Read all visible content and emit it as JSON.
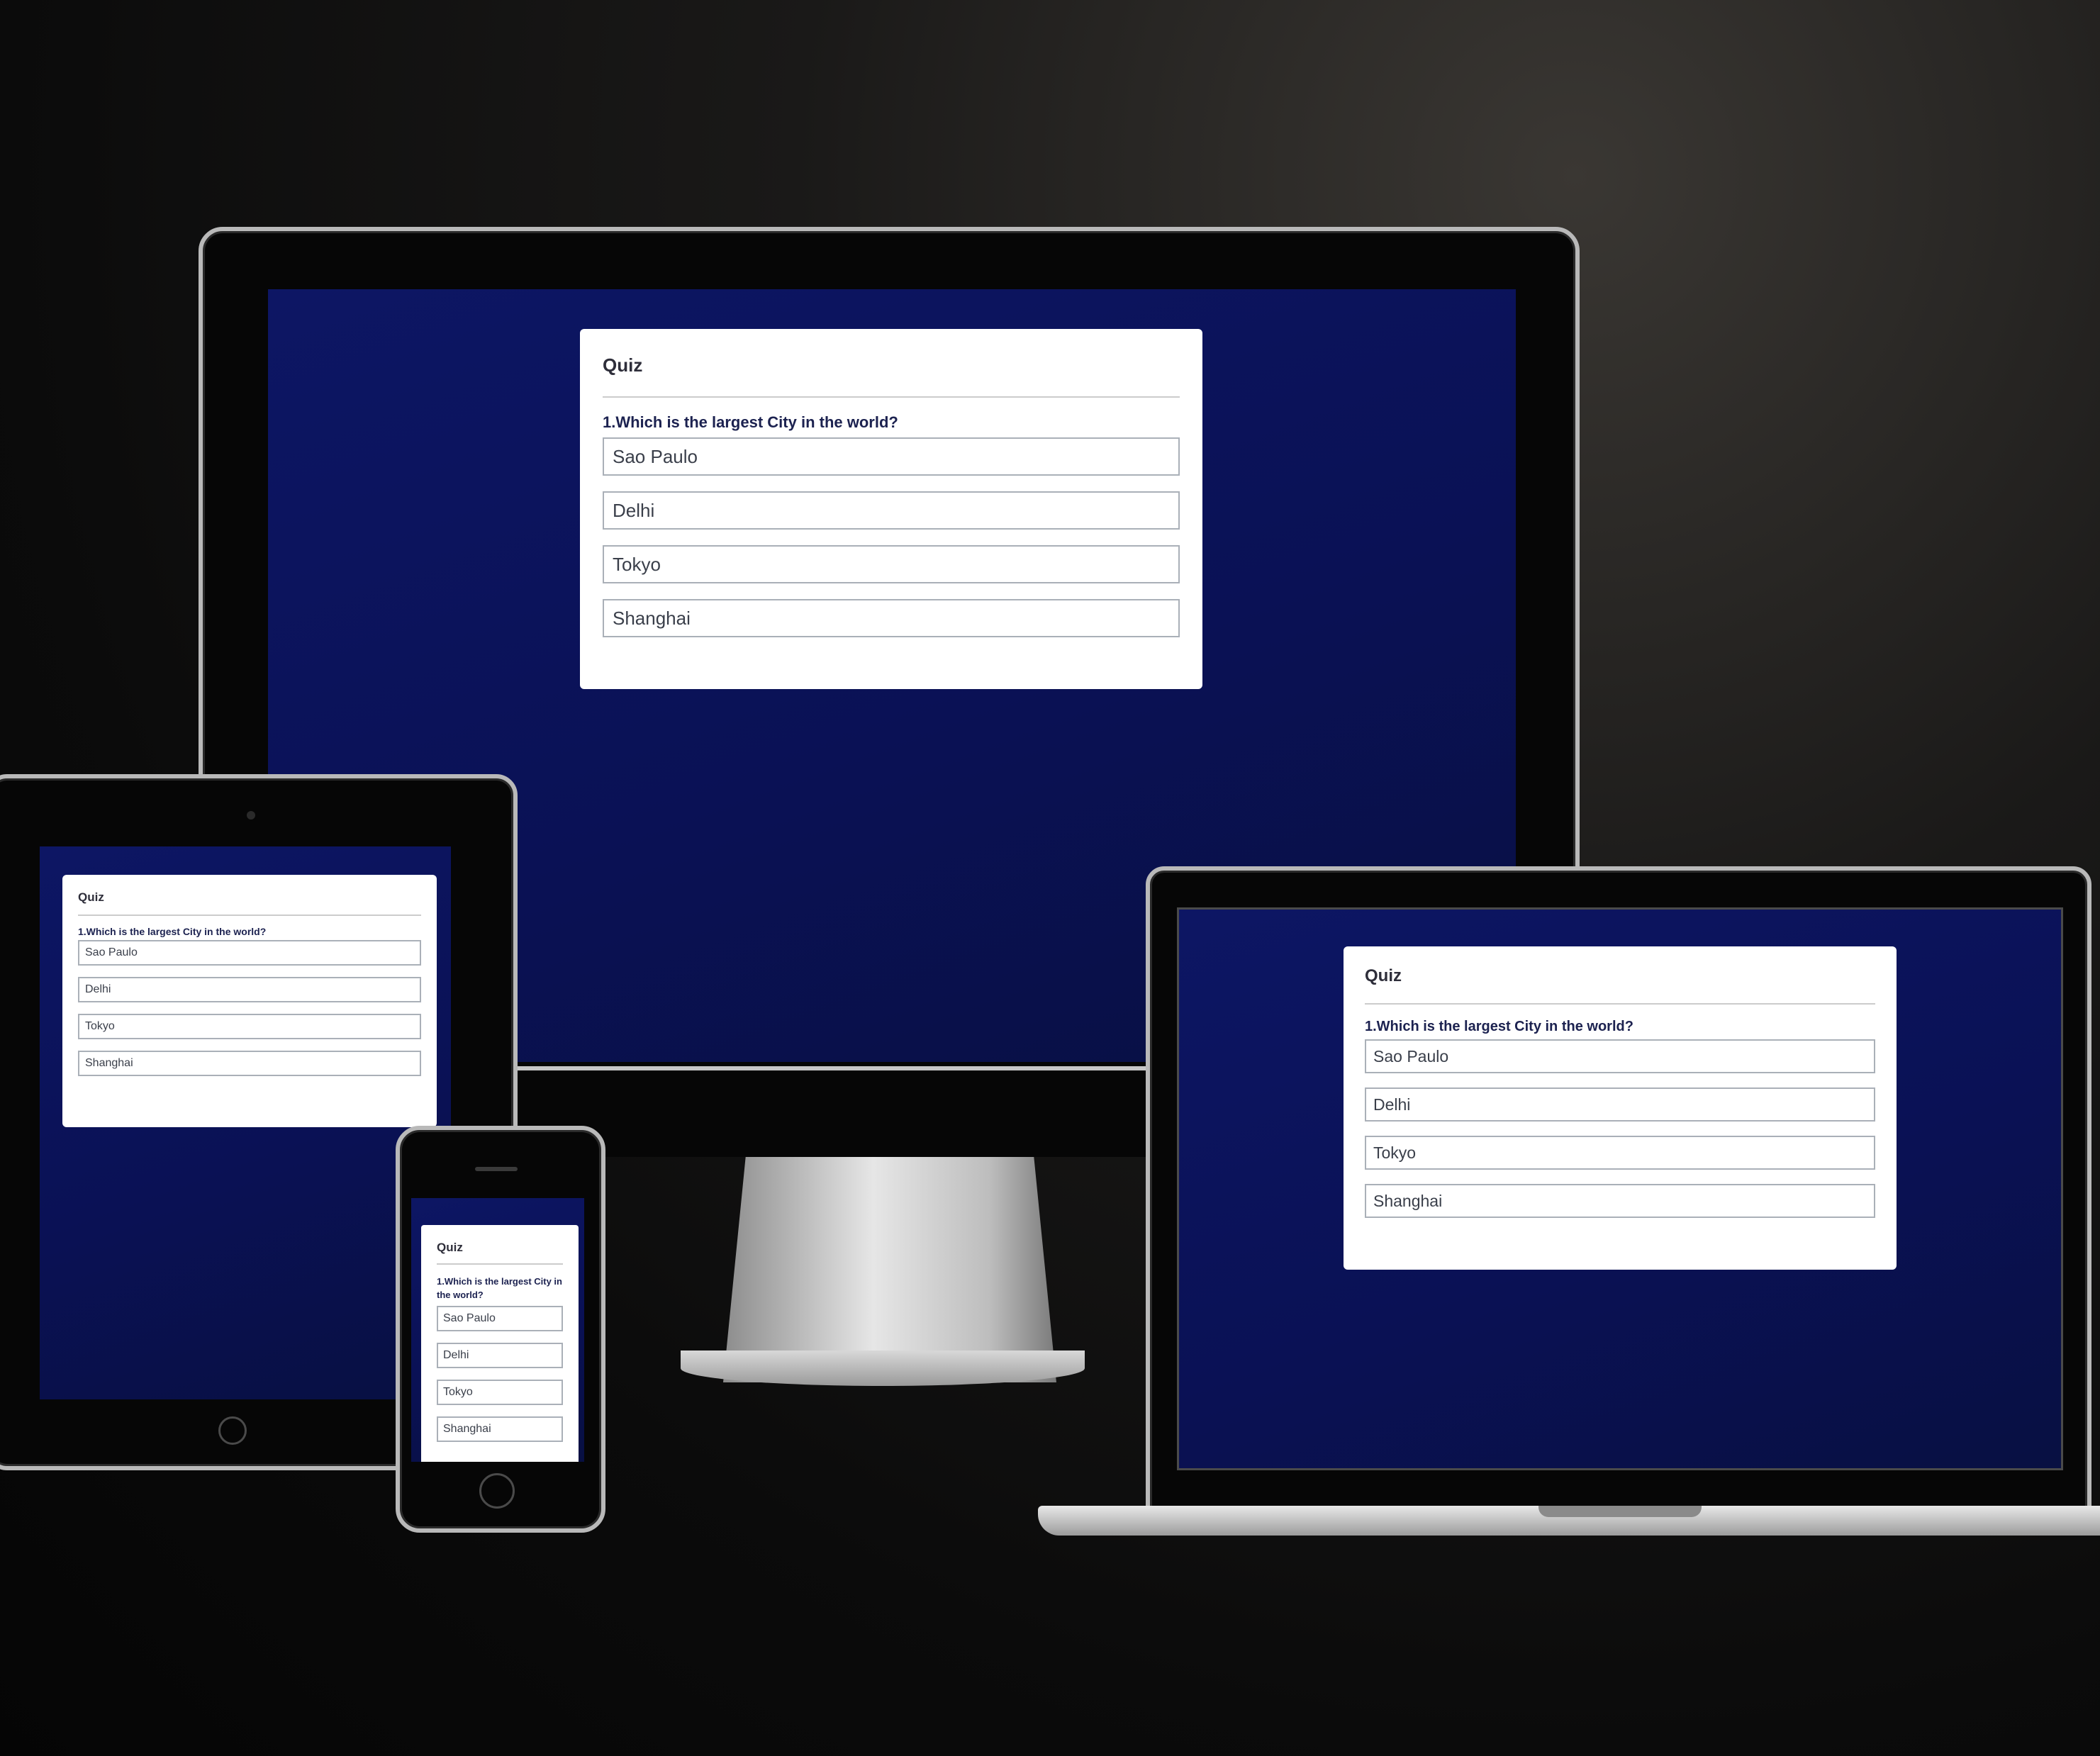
{
  "quiz": {
    "title": "Quiz",
    "question": "1.Which is the largest City in the world?",
    "options": [
      "Sao Paulo",
      "Delhi",
      "Tokyo",
      "Shanghai"
    ]
  },
  "colors": {
    "screen_background": "#0a1155",
    "card_background": "#ffffff",
    "option_border": "#aab0b8"
  },
  "devices": [
    "desktop-monitor",
    "tablet",
    "phone",
    "laptop"
  ]
}
